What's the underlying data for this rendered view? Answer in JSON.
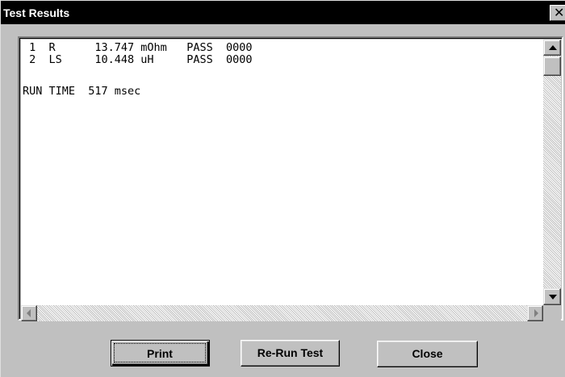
{
  "window": {
    "title": "Test Results",
    "close_glyph": "✕"
  },
  "results": {
    "lines": [
      " 1  R      13.747 mOhm   PASS  0000",
      " 2  LS     10.448 uH     PASS  0000",
      "",
      "RUN TIME  517 msec"
    ]
  },
  "buttons": {
    "print": "Print",
    "rerun": "Re-Run Test",
    "close": "Close"
  },
  "icons": {
    "scroll_up": "scroll-up-arrow-icon",
    "scroll_down": "scroll-down-arrow-icon",
    "scroll_left": "scroll-left-arrow-icon",
    "scroll_right": "scroll-right-arrow-icon"
  },
  "colors": {
    "titlebar": "#000000",
    "face": "#c0c0c0",
    "text_bg": "#ffffff"
  }
}
